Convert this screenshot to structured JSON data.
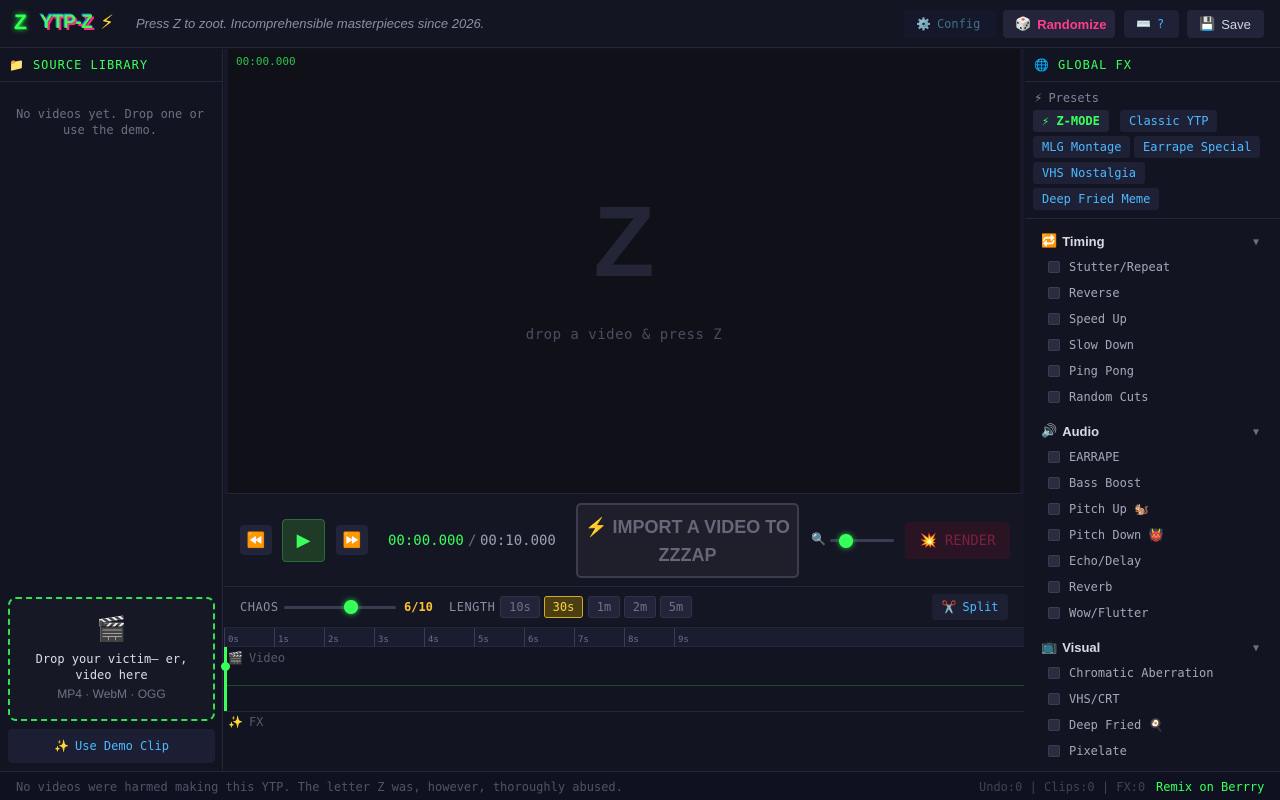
{
  "header": {
    "logo_mark": "Z",
    "logo_text": "YTP-Z",
    "logo_bolt": "⚡",
    "tagline": "Press Z to zoot. Incomprehensible masterpieces since 2026.",
    "config_label": "Config",
    "randomize_label": "Randomize",
    "help_label": "?",
    "save_label": "Save"
  },
  "library": {
    "title": "SOURCE LIBRARY",
    "empty_message": "No videos yet. Drop one or use the demo.",
    "dropzone_text": "Drop your victim— er, video here",
    "dropzone_formats": "MP4 · WebM · OGG",
    "demo_button": "Use Demo Clip"
  },
  "preview": {
    "timecode": "00:00.000",
    "placeholder_glyph": "Z",
    "hint": "drop a video & press Z"
  },
  "transport": {
    "current_time": "00:00.000",
    "separator": "/",
    "total_time": "00:10.000",
    "import_label": "⚡ IMPORT A VIDEO TO ZZZAP",
    "render_label": "RENDER",
    "zoom_level": 0.25
  },
  "controls": {
    "chaos_label": "CHAOS",
    "chaos_value": "6/10",
    "chaos_level": 6,
    "chaos_max": 10,
    "length_label": "LENGTH",
    "lengths": [
      "10s",
      "30s",
      "1m",
      "2m",
      "5m"
    ],
    "selected_length": "30s",
    "split_label": "Split"
  },
  "timeline": {
    "ticks": [
      "0s",
      "1s",
      "2s",
      "3s",
      "4s",
      "5s",
      "6s",
      "7s",
      "8s",
      "9s"
    ],
    "video_track": "Video",
    "fx_track": "FX"
  },
  "fx_panel": {
    "title": "GLOBAL FX",
    "presets_label": "Presets",
    "presets": [
      "⚡ Z-MODE",
      "Classic YTP",
      "MLG Montage",
      "Earrape Special",
      "VHS Nostalgia",
      "Deep Fried Meme"
    ],
    "categories": [
      {
        "name": "Timing",
        "icon": "🔁",
        "items": [
          "Stutter/Repeat",
          "Reverse",
          "Speed Up",
          "Slow Down",
          "Ping Pong",
          "Random Cuts"
        ]
      },
      {
        "name": "Audio",
        "icon": "🔊",
        "items": [
          "EARRAPE",
          "Bass Boost",
          "Pitch Up 🐿️",
          "Pitch Down 👹",
          "Echo/Delay",
          "Reverb",
          "Wow/Flutter"
        ]
      },
      {
        "name": "Visual",
        "icon": "📺",
        "items": [
          "Chromatic Aberration",
          "VHS/CRT",
          "Deep Fried 🍳",
          "Pixelate"
        ]
      }
    ]
  },
  "status": {
    "message": "No videos were harmed making this YTP. The letter Z was, however, thoroughly abused.",
    "counters": "Undo:0 | Clips:0 | FX:0",
    "remix": "Remix on Berrry"
  },
  "colors": {
    "accent": "#39ff5a",
    "warning": "#ffc233",
    "link": "#4bb8ff",
    "danger": "#ff3d8b"
  }
}
